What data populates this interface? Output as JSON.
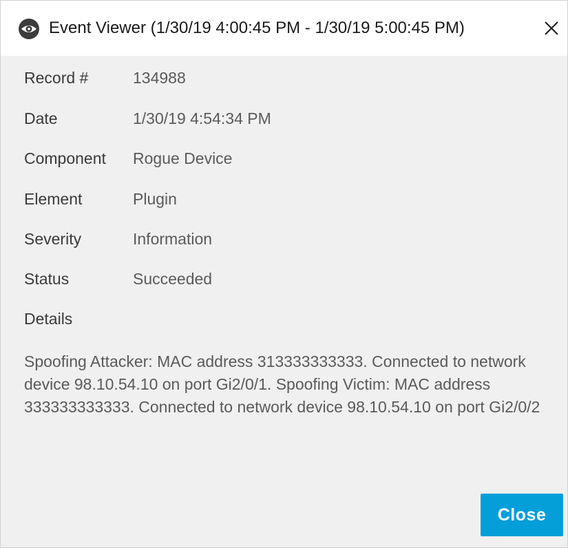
{
  "window": {
    "title": "Event Viewer (1/30/19 4:00:45 PM - 1/30/19 5:00:45 PM)",
    "app_icon": "eye-icon",
    "close_icon": "close-icon"
  },
  "fields": [
    {
      "label": "Record #",
      "value": "134988"
    },
    {
      "label": "Date",
      "value": "1/30/19 4:54:34 PM"
    },
    {
      "label": "Component",
      "value": "Rogue Device"
    },
    {
      "label": "Element",
      "value": "Plugin"
    },
    {
      "label": "Severity",
      "value": "Information"
    },
    {
      "label": "Status",
      "value": "Succeeded"
    }
  ],
  "details": {
    "label": "Details",
    "text": "Spoofing Attacker: MAC address 313333333333. Connected to network device 98.10.54.10 on port Gi2/0/1. Spoofing Victim: MAC address 333333333333. Connected to network device 98.10.54.10 on port Gi2/0/2"
  },
  "footer": {
    "close_label": "Close"
  },
  "colors": {
    "accent": "#049fd9",
    "background": "#f0f0f0",
    "titlebar": "#ffffff"
  }
}
